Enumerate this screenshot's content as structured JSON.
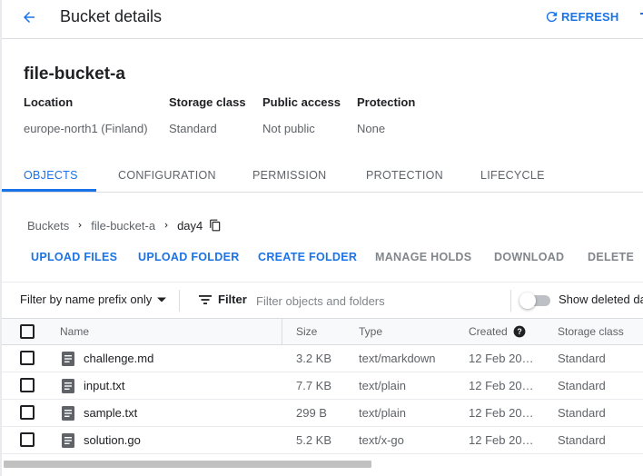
{
  "header": {
    "title": "Bucket details",
    "refresh_label": "REFRESH"
  },
  "bucket": {
    "name": "file-bucket-a",
    "info": [
      {
        "label": "Location",
        "value": "europe-north1 (Finland)"
      },
      {
        "label": "Storage class",
        "value": "Standard"
      },
      {
        "label": "Public access",
        "value": "Not public"
      },
      {
        "label": "Protection",
        "value": "None"
      }
    ]
  },
  "tabs": [
    {
      "label": "OBJECTS",
      "active": true
    },
    {
      "label": "CONFIGURATION",
      "active": false
    },
    {
      "label": "PERMISSION",
      "active": false
    },
    {
      "label": "PROTECTION",
      "active": false
    },
    {
      "label": "LIFECYCLE",
      "active": false
    }
  ],
  "breadcrumb": [
    "Buckets",
    "file-bucket-a",
    "day4"
  ],
  "actions": [
    {
      "label": "UPLOAD FILES",
      "enabled": true
    },
    {
      "label": "UPLOAD FOLDER",
      "enabled": true
    },
    {
      "label": "CREATE FOLDER",
      "enabled": true
    },
    {
      "label": "MANAGE HOLDS",
      "enabled": false
    },
    {
      "label": "DOWNLOAD",
      "enabled": false
    },
    {
      "label": "DELETE",
      "enabled": false
    }
  ],
  "filter": {
    "prefix_label": "Filter by name prefix only",
    "filter_label": "Filter",
    "placeholder": "Filter objects and folders",
    "show_deleted_label": "Show deleted da"
  },
  "table": {
    "columns": [
      "Name",
      "Size",
      "Type",
      "Created",
      "Storage class"
    ],
    "rows": [
      {
        "name": "challenge.md",
        "size": "3.2 KB",
        "type": "text/markdown",
        "created": "12 Feb 20…",
        "storage_class": "Standard"
      },
      {
        "name": "input.txt",
        "size": "7.7 KB",
        "type": "text/plain",
        "created": "12 Feb 20…",
        "storage_class": "Standard"
      },
      {
        "name": "sample.txt",
        "size": "299 B",
        "type": "text/plain",
        "created": "12 Feb 20…",
        "storage_class": "Standard"
      },
      {
        "name": "solution.go",
        "size": "5.2 KB",
        "type": "text/x-go",
        "created": "12 Feb 20…",
        "storage_class": "Standard"
      }
    ]
  },
  "colors": {
    "accent": "#1a73e8",
    "text": "#202124",
    "muted": "#5f6368",
    "disabled": "#80868b"
  },
  "icons": {
    "back": "arrow-back-icon",
    "refresh": "refresh-icon",
    "chevron": "chevron-right-icon",
    "copy": "copy-icon",
    "filter": "filter-list-icon",
    "dropdown": "caret-down-icon",
    "help": "help-icon",
    "file": "document-icon"
  }
}
